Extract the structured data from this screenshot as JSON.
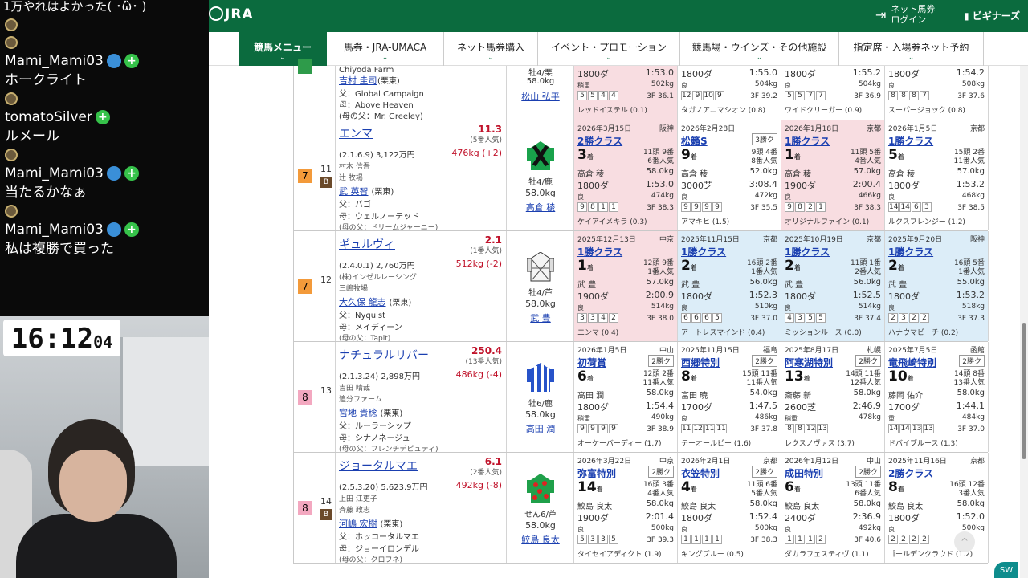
{
  "stream": {
    "top_line": "1万やれはよかった( ･ὢ･ )",
    "chat": [
      {
        "name": "Mami_Mami03",
        "msg": "ホークライト"
      },
      {
        "name": "tomatoSilver",
        "msg": "ルメール"
      },
      {
        "name": "Mami_Mami03",
        "msg": "当たるかなぁ"
      },
      {
        "name": "Mami_Mami03",
        "msg": "私は複勝で買った"
      }
    ],
    "clock_hm": "16:12",
    "clock_ss": "04"
  },
  "header": {
    "logo": "JRA",
    "login_line1": "ネット馬券",
    "login_line2": "ログイン",
    "beginner": "ビギナーズ"
  },
  "nav": [
    {
      "label": "競馬メニュー"
    },
    {
      "label": "馬券・JRA-UMACA"
    },
    {
      "label": "ネット馬券購入"
    },
    {
      "label": "イベント・プロモーション"
    },
    {
      "label": "競馬場・ウインズ・その他施設"
    },
    {
      "label": "指定席・入場券ネット予約"
    }
  ],
  "top_partial": {
    "farm": "Chiyoda Farm",
    "owner_short": "吉村 圭司",
    "trainer_region": "(栗東)",
    "father": "父：Global Campaign",
    "mother": "母：Above Heaven",
    "mf": "(母の父：Mr. Greeley)",
    "sex": "牡4/栗",
    "kg": "58.0kg",
    "jockey": "松山 弘平",
    "past": [
      {
        "ds": "1800ダ",
        "tm": "1:53.0",
        "cd": "稍重",
        "bw": "502kg",
        "ps": [
          "5",
          "5",
          "4",
          "4"
        ],
        "f3": "3F 36.1",
        "wn": "レッドイステル (0.1)"
      },
      {
        "ds": "1800ダ",
        "tm": "1:55.0",
        "cd": "良",
        "bw": "504kg",
        "ps": [
          "12",
          "9",
          "10",
          "9"
        ],
        "f3": "3F 39.2",
        "wn": "タガノアニマシオン (0.8)"
      },
      {
        "ds": "1800ダ",
        "tm": "1:55.2",
        "cd": "良",
        "bw": "504kg",
        "ps": [
          "5",
          "5",
          "7",
          "7"
        ],
        "f3": "3F 36.9",
        "wn": "ワイドクリーガー (0.9)"
      },
      {
        "ds": "1800ダ",
        "tm": "1:54.2",
        "cd": "良",
        "bw": "508kg",
        "ps": [
          "8",
          "8",
          "8",
          "7"
        ],
        "f3": "3F 37.6",
        "wn": "スーパージョック (0.8)"
      }
    ]
  },
  "horses": [
    {
      "waku": "7",
      "num": "11",
      "blinker": "B",
      "name": "エンマ",
      "odds": "11.3",
      "pop": "(5番人気)",
      "info": "(2.1.6.9) 3,122万円",
      "weight": "476kg (+2)",
      "owner": "村木 信吾",
      "breeder": "辻 牧場",
      "trainer": "武 英智",
      "region": "(栗東)",
      "father": "父：バゴ",
      "mother": "母：ウェルノーテッド",
      "mf": "(母の父：ドリームジャーニー)",
      "sex": "牡4/鹿",
      "kg": "58.0kg",
      "jockey": "高倉 稜",
      "past": [
        {
          "dt": "2026年3月15日",
          "vn": "阪神",
          "rn": "2勝クラス",
          "gb": "",
          "pl": "3",
          "hc": "11頭 9番\n6番人気",
          "jk": "高倉 稜",
          "jw": "58.0kg",
          "ds": "1800ダ",
          "tm": "1:53.0",
          "cd": "良",
          "bw": "474kg",
          "ps": [
            "9",
            "8",
            "1",
            "1"
          ],
          "f3": "3F 38.3",
          "wn": "ケイアイメキラ (0.3)",
          "bg": "red"
        },
        {
          "dt": "2026年2月28日",
          "vn": "",
          "rn": "松籟S",
          "gb": "3勝ク",
          "pl": "9",
          "hc": "9頭 4番\n8番人気",
          "jk": "高倉 稜",
          "jw": "52.0kg",
          "ds": "3000芝",
          "tm": "3:08.4",
          "cd": "良",
          "bw": "472kg",
          "ps": [
            "9",
            "9",
            "9",
            "9"
          ],
          "f3": "3F 35.5",
          "wn": "アマキヒ (1.5)",
          "bg": ""
        },
        {
          "dt": "2026年1月18日",
          "vn": "京都",
          "rn": "1勝クラス",
          "gb": "",
          "pl": "1",
          "hc": "11頭 5番\n4番人気",
          "jk": "高倉 稜",
          "jw": "57.0kg",
          "ds": "1900ダ",
          "tm": "2:00.4",
          "cd": "良",
          "bw": "466kg",
          "ps": [
            "9",
            "8",
            "2",
            "1"
          ],
          "f3": "3F 38.3",
          "wn": "オリジナルファイン (0.1)",
          "bg": "red"
        },
        {
          "dt": "2026年1月5日",
          "vn": "京都",
          "rn": "1勝クラス",
          "gb": "",
          "pl": "5",
          "hc": "15頭 2番\n11番人気",
          "jk": "高倉 稜",
          "jw": "57.0kg",
          "ds": "1800ダ",
          "tm": "1:53.2",
          "cd": "良",
          "bw": "468kg",
          "ps": [
            "14",
            "14",
            "6",
            "3"
          ],
          "f3": "3F 38.5",
          "wn": "ルクスフレンジー (1.2)",
          "bg": ""
        }
      ]
    },
    {
      "waku": "7",
      "num": "12",
      "blinker": "",
      "name": "ギュルヴィ",
      "odds": "2.1",
      "pop": "(1番人気)",
      "info": "(2.4.0.1) 2,760万円",
      "weight": "512kg (-2)",
      "owner": "(株)インゼルレーシング",
      "breeder": "三嶋牧場",
      "trainer": "大久保 龍志",
      "region": "(栗東)",
      "father": "父：Nyquist",
      "mother": "母：メイディーン",
      "mf": "(母の父：Tapit)",
      "sex": "牡4/芦",
      "kg": "58.0kg",
      "jockey": "武 豊",
      "past": [
        {
          "dt": "2025年12月13日",
          "vn": "中京",
          "rn": "1勝クラス",
          "gb": "",
          "pl": "1",
          "hc": "12頭 9番\n1番人気",
          "jk": "武 豊",
          "jw": "57.0kg",
          "ds": "1900ダ",
          "tm": "2:00.9",
          "cd": "良",
          "bw": "514kg",
          "ps": [
            "3",
            "3",
            "4",
            "2"
          ],
          "f3": "3F 38.0",
          "wn": "エンマ (0.4)",
          "bg": "red"
        },
        {
          "dt": "2025年11月15日",
          "vn": "京都",
          "rn": "1勝クラス",
          "gb": "",
          "pl": "2",
          "hc": "16頭 2番\n1番人気",
          "jk": "武 豊",
          "jw": "56.0kg",
          "ds": "1800ダ",
          "tm": "1:52.3",
          "cd": "良",
          "bw": "510kg",
          "ps": [
            "6",
            "6",
            "6",
            "5"
          ],
          "f3": "3F 37.0",
          "wn": "アートレスマインド (0.4)",
          "bg": "blue"
        },
        {
          "dt": "2025年10月19日",
          "vn": "京都",
          "rn": "1勝クラス",
          "gb": "",
          "pl": "2",
          "hc": "11頭 1番\n2番人気",
          "jk": "武 豊",
          "jw": "56.0kg",
          "ds": "1800ダ",
          "tm": "1:52.5",
          "cd": "良",
          "bw": "514kg",
          "ps": [
            "4",
            "3",
            "5",
            "5"
          ],
          "f3": "3F 37.4",
          "wn": "ミッションルース (0.0)",
          "bg": "blue"
        },
        {
          "dt": "2025年9月20日",
          "vn": "阪神",
          "rn": "1勝クラス",
          "gb": "",
          "pl": "2",
          "hc": "16頭 5番\n1番人気",
          "jk": "武 豊",
          "jw": "55.0kg",
          "ds": "1800ダ",
          "tm": "1:53.2",
          "cd": "良",
          "bw": "518kg",
          "ps": [
            "2",
            "3",
            "2",
            "2"
          ],
          "f3": "3F 37.3",
          "wn": "ハナウマビーチ (0.2)",
          "bg": "blue"
        }
      ]
    },
    {
      "waku": "8",
      "num": "13",
      "blinker": "",
      "name": "ナチュラルリバー",
      "odds": "250.4",
      "pop": "(13番人気)",
      "info": "(2.1.3.24) 2,898万円",
      "weight": "486kg (-4)",
      "owner": "吉田 晴哉",
      "breeder": "追分ファーム",
      "trainer": "宮地 貴稔",
      "region": "(栗東)",
      "father": "父：ルーラーシップ",
      "mother": "母：シナノネージュ",
      "mf": "(母の父：フレンチデピュティ)",
      "sex": "牡6/鹿",
      "kg": "58.0kg",
      "jockey": "高田 潤",
      "past": [
        {
          "dt": "2026年1月5日",
          "vn": "中山",
          "rn": "初荷賞",
          "gb": "2勝ク",
          "pl": "6",
          "hc": "12頭 2番\n11番人気",
          "jk": "高田 潤",
          "jw": "58.0kg",
          "ds": "1800ダ",
          "tm": "1:54.4",
          "cd": "稍重",
          "bw": "490kg",
          "ps": [
            "9",
            "9",
            "9",
            "9"
          ],
          "f3": "3F 38.9",
          "wn": "オーケーバーディー (1.7)",
          "bg": ""
        },
        {
          "dt": "2025年11月15日",
          "vn": "福島",
          "rn": "西郷特別",
          "gb": "2勝ク",
          "pl": "8",
          "hc": "15頭 11番\n11番人気",
          "jk": "富田 暁",
          "jw": "54.0kg",
          "ds": "1700ダ",
          "tm": "1:47.5",
          "cd": "良",
          "bw": "486kg",
          "ps": [
            "11",
            "12",
            "11",
            "11"
          ],
          "f3": "3F 37.8",
          "wn": "テーオールビー (1.6)",
          "bg": ""
        },
        {
          "dt": "2025年8月17日",
          "vn": "札幌",
          "rn": "阿寒湖特別",
          "gb": "2勝ク",
          "pl": "13",
          "hc": "14頭 11番\n12番人気",
          "jk": "斎藤 新",
          "jw": "58.0kg",
          "ds": "2600芝",
          "tm": "2:46.9",
          "cd": "稍重",
          "bw": "478kg",
          "ps": [
            "8",
            "8",
            "12",
            "13"
          ],
          "f3": "",
          "wn": "レクスノヴァス (3.7)",
          "bg": ""
        },
        {
          "dt": "2025年7月5日",
          "vn": "函館",
          "rn": "竜飛崎特別",
          "gb": "2勝ク",
          "pl": "10",
          "hc": "14頭 8番\n13番人気",
          "jk": "藤岡 佑介",
          "jw": "58.0kg",
          "ds": "1700ダ",
          "tm": "1:44.1",
          "cd": "重",
          "bw": "484kg",
          "ps": [
            "14",
            "14",
            "13",
            "13"
          ],
          "f3": "3F 37.0",
          "wn": "ドバイブルース (1.3)",
          "bg": ""
        }
      ]
    },
    {
      "waku": "8",
      "num": "14",
      "blinker": "B",
      "name": "ジョータルマエ",
      "odds": "6.1",
      "pop": "(2番人気)",
      "info": "(2.5.3.20) 5,623.9万円",
      "weight": "492kg (-8)",
      "owner": "上田 江吏子",
      "breeder": "斉藤 政志",
      "trainer": "河嶋 宏樹",
      "region": "(栗東)",
      "father": "父：ホッコータルマエ",
      "mother": "母：ジョーイロンデル",
      "mf": "(母の父：クロフネ)",
      "sex": "せん6/芦",
      "kg": "58.0kg",
      "jockey": "鮫島 良太",
      "past": [
        {
          "dt": "2026年3月22日",
          "vn": "中京",
          "rn": "弥富特別",
          "gb": "2勝ク",
          "pl": "14",
          "hc": "16頭 3番\n4番人気",
          "jk": "鮫島 良太",
          "jw": "58.0kg",
          "ds": "1900ダ",
          "tm": "2:01.4",
          "cd": "良",
          "bw": "500kg",
          "ps": [
            "5",
            "3",
            "3",
            "5"
          ],
          "f3": "3F 39.3",
          "wn": "タイセイアディクト (1.9)",
          "bg": ""
        },
        {
          "dt": "2026年2月1日",
          "vn": "京都",
          "rn": "衣笠特別",
          "gb": "2勝ク",
          "pl": "4",
          "hc": "11頭 6番\n5番人気",
          "jk": "鮫島 良太",
          "jw": "58.0kg",
          "ds": "1800ダ",
          "tm": "1:52.4",
          "cd": "良",
          "bw": "500kg",
          "ps": [
            "1",
            "1",
            "1",
            "1"
          ],
          "f3": "3F 38.3",
          "wn": "キングブルー (0.5)",
          "bg": ""
        },
        {
          "dt": "2026年1月12日",
          "vn": "中山",
          "rn": "成田特別",
          "gb": "2勝ク",
          "pl": "6",
          "hc": "13頭 11番\n6番人気",
          "jk": "鮫島 良太",
          "jw": "58.0kg",
          "ds": "2400ダ",
          "tm": "2:36.9",
          "cd": "良",
          "bw": "492kg",
          "ps": [
            "1",
            "1",
            "1",
            "2"
          ],
          "f3": "3F 40.6",
          "wn": "ダカラフェスティヴ (1.1)",
          "bg": ""
        },
        {
          "dt": "2025年11月16日",
          "vn": "京都",
          "rn": "2勝クラス",
          "gb": "",
          "pl": "8",
          "hc": "16頭 12番\n3番人気",
          "jk": "鮫島 良太",
          "jw": "58.0kg",
          "ds": "1800ダ",
          "tm": "1:52.0",
          "cd": "良",
          "bw": "500kg",
          "ps": [
            "2",
            "2",
            "2",
            "2"
          ],
          "f3": "",
          "wn": "ゴールデンクラウド (1.2)",
          "bg": ""
        }
      ]
    }
  ],
  "colors": {
    "jra_green": "#0b6b3e",
    "waku7": "#f39a3a",
    "waku8": "#f3a8c0",
    "link": "#1a3fb0",
    "odds_red": "#c0122a"
  },
  "ui": {
    "place_unit": "着",
    "to_top": "^",
    "corner_badge": "SW"
  }
}
